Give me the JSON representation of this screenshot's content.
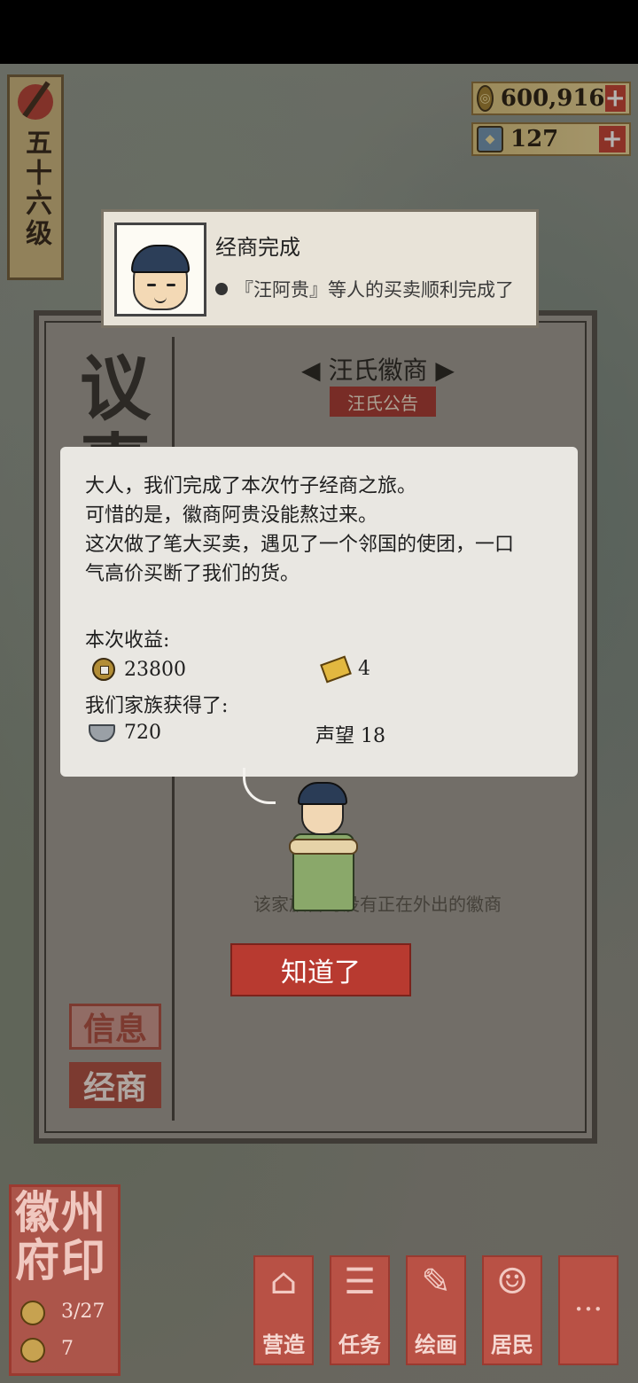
{
  "level": {
    "text": "五十六级"
  },
  "currency": {
    "coins": {
      "value": "600,916",
      "icon": "coin-icon"
    },
    "tickets": {
      "value": "127",
      "icon": "gem-icon"
    }
  },
  "notification": {
    "title": "经商完成",
    "message": "『汪阿贵』等人的买卖顺利完成了"
  },
  "panel": {
    "big_char_1": "议",
    "big_char_2": "事",
    "shop_title": "汪氏徽商",
    "shop_title_left": "◀",
    "shop_title_right": "▶",
    "notice_button": "汪氏公告",
    "empty_text": "该家族暂时没有正在外出的徽商",
    "tabs": {
      "info": "信息",
      "trade": "经商"
    }
  },
  "dialog": {
    "story": [
      "大人，我们完成了本次竹子经商之旅。",
      "可惜的是，徽商阿贵没能熬过来。",
      "这次做了笔大买卖，遇见了一个邻国的使团，一口",
      "气高价买断了我们的货。"
    ],
    "income_label": "本次收益:",
    "income_coins": "23800",
    "income_gold": "4",
    "family_label": "我们家族获得了:",
    "family_silver": "720",
    "family_reputation": "声望 18"
  },
  "ok_button": "知道了",
  "seal": {
    "chars": "徽州府印",
    "count_1": "3/27",
    "count_2": "7"
  },
  "bottom_nav": [
    {
      "label": "营造",
      "glyph": "⌂"
    },
    {
      "label": "任务",
      "glyph": "☰"
    },
    {
      "label": "绘画",
      "glyph": "✎"
    },
    {
      "label": "居民",
      "glyph": "☺"
    },
    {
      "label": "",
      "glyph": "···"
    }
  ],
  "colors": {
    "accent_red": "#b83a30",
    "panel_gray": "#9a9690",
    "dialog_bg": "#e9e7e2"
  }
}
